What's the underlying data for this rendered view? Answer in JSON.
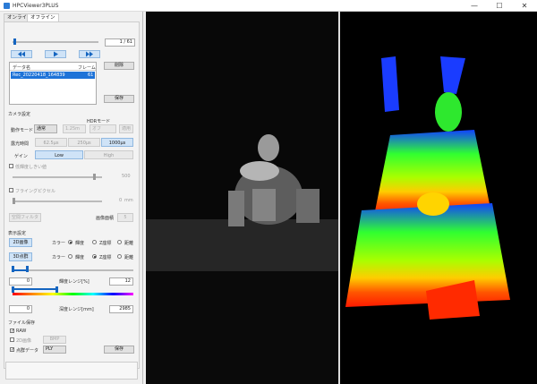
{
  "app": {
    "title": "HPCViewer3PLUS"
  },
  "window_controls": {
    "minimize": "—",
    "maximize": "☐",
    "close": "✕"
  },
  "tabs": [
    {
      "label": "オンライン"
    },
    {
      "label": "オフライン"
    }
  ],
  "playback": {
    "frame_counter": "1 / 61",
    "progress": 0.02
  },
  "list": {
    "col_name": "データ名",
    "col_frame": "フレーム",
    "rows": [
      {
        "name": "Rec_20220418_164839",
        "frames": "61"
      }
    ],
    "delete_label": "削除",
    "save_label": "保存"
  },
  "camera": {
    "section": "カメラ設定",
    "hdr_mode_label": "HDRモード",
    "mode_label": "動作モード",
    "mode_value": "通常",
    "range_value": "1.25m",
    "hdr_value": "オフ",
    "apply_label": "適用",
    "exposure_label": "露光時間",
    "exposure_options": [
      "62.5μs",
      "250μs",
      "1000μs"
    ],
    "exposure_selected": 2,
    "gain_label": "ゲイン",
    "gain_options": [
      "Low",
      "High"
    ],
    "gain_selected": 0,
    "low_reflect_label": "低輝度しきい値",
    "low_reflect_value": "500",
    "flying_pixel_label": "フライングピクセル",
    "flying_pixel_value": "0",
    "spatial_filter_label": "空間フィルタ",
    "image_size_label": "画像面積",
    "image_size_value": "5",
    "flying_pixel_unit": "mm"
  },
  "display": {
    "section": "表示設定",
    "btn_2d": "2D画像",
    "btn_3d": "3D点群",
    "color_label": "カラー",
    "options": [
      "輝度",
      "Z座標",
      "距離"
    ],
    "row1_selected": 0,
    "row2_selected": 1,
    "brightness_label": "輝度レンジ[%]",
    "brightness_min": "0",
    "brightness_max": "12",
    "depth_label": "深度レンジ[mm]",
    "depth_min": "0",
    "depth_max": "2985"
  },
  "filesave": {
    "section": "ファイル保存",
    "raw_label": "RAW",
    "raw_checked": true,
    "img2d_label": "2D画像",
    "img2d_checked": false,
    "img2d_format": "BMP",
    "pointcloud_label": "点群データ",
    "pointcloud_checked": true,
    "pointcloud_format": "PLY",
    "save_label": "保存"
  },
  "colors": {
    "accent": "#1e73d8",
    "thumb": "#1565c0"
  }
}
